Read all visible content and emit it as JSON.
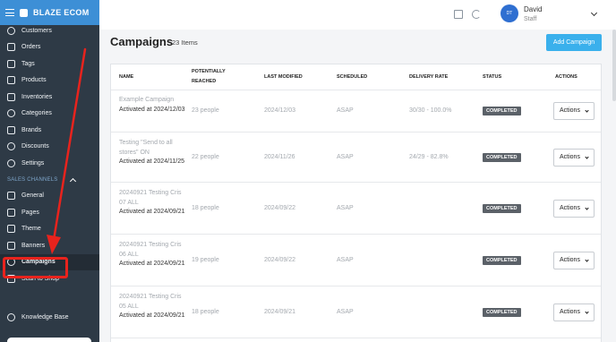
{
  "sidebar": {
    "brand": "BLAZE ECOM",
    "items": [
      {
        "label": "Customers",
        "icon": "users-icon"
      },
      {
        "label": "Orders",
        "icon": "orders-icon"
      },
      {
        "label": "Tags",
        "icon": "tag-icon"
      },
      {
        "label": "Products",
        "icon": "box-icon"
      },
      {
        "label": "Inventories",
        "icon": "inventory-icon"
      },
      {
        "label": "Categories",
        "icon": "categories-icon"
      },
      {
        "label": "Brands",
        "icon": "book-icon"
      },
      {
        "label": "Discounts",
        "icon": "discount-icon"
      },
      {
        "label": "Settings",
        "icon": "gear-icon"
      }
    ],
    "sales_channels_label": "SALES CHANNELS",
    "channel_items": [
      {
        "label": "General",
        "icon": "general-icon"
      },
      {
        "label": "Pages",
        "icon": "pages-icon"
      },
      {
        "label": "Theme",
        "icon": "theme-icon"
      },
      {
        "label": "Banners",
        "icon": "banner-icon"
      },
      {
        "label": "Campaigns",
        "icon": "bell-icon"
      },
      {
        "label": "Scan to Shop",
        "icon": "scan-icon"
      }
    ],
    "knowledge_base": "Knowledge Base"
  },
  "topbar": {
    "avatar_initials": "DT",
    "user_name": "David",
    "user_role": "Staff"
  },
  "main": {
    "title": "Campaigns",
    "count": "23 Items",
    "add_button": "Add Campaign",
    "columns": [
      "NAME",
      "POTENTIALLY REACHED",
      "LAST MODIFIED",
      "SCHEDULED",
      "DELIVERY RATE",
      "STATUS",
      "ACTIONS"
    ],
    "rows": [
      {
        "name": "Example Campaign",
        "activated": "Activated at 2024/12/03",
        "reached": "23 people",
        "modified": "2024/12/03",
        "scheduled": "ASAP",
        "delivery": "30/30 - 100.0%",
        "status": "COMPLETED",
        "action": "Actions"
      },
      {
        "name": "Testing \"Send to all stores\" ON",
        "activated": "Activated at 2024/11/25",
        "reached": "22 people",
        "modified": "2024/11/26",
        "scheduled": "ASAP",
        "delivery": "24/29 - 82.8%",
        "status": "COMPLETED",
        "action": "Actions"
      },
      {
        "name": "20240921 Testing Cris 07 ALL",
        "activated": "Activated at 2024/09/21",
        "reached": "18 people",
        "modified": "2024/09/22",
        "scheduled": "ASAP",
        "delivery": "",
        "status": "COMPLETED",
        "action": "Actions"
      },
      {
        "name": "20240921 Testing Cris 06 ALL",
        "activated": "Activated at 2024/09/21",
        "reached": "19 people",
        "modified": "2024/09/22",
        "scheduled": "ASAP",
        "delivery": "",
        "status": "COMPLETED",
        "action": "Actions"
      },
      {
        "name": "20240921 Testing Cris 05 ALL",
        "activated": "Activated at 2024/09/21",
        "reached": "18 people",
        "modified": "2024/09/21",
        "scheduled": "ASAP",
        "delivery": "",
        "status": "COMPLETED",
        "action": "Actions"
      }
    ]
  },
  "colors": {
    "accent": "#3d8fd6",
    "sidebar": "#2e3a46",
    "highlight": "#e8231d",
    "button": "#3ab0ec"
  }
}
